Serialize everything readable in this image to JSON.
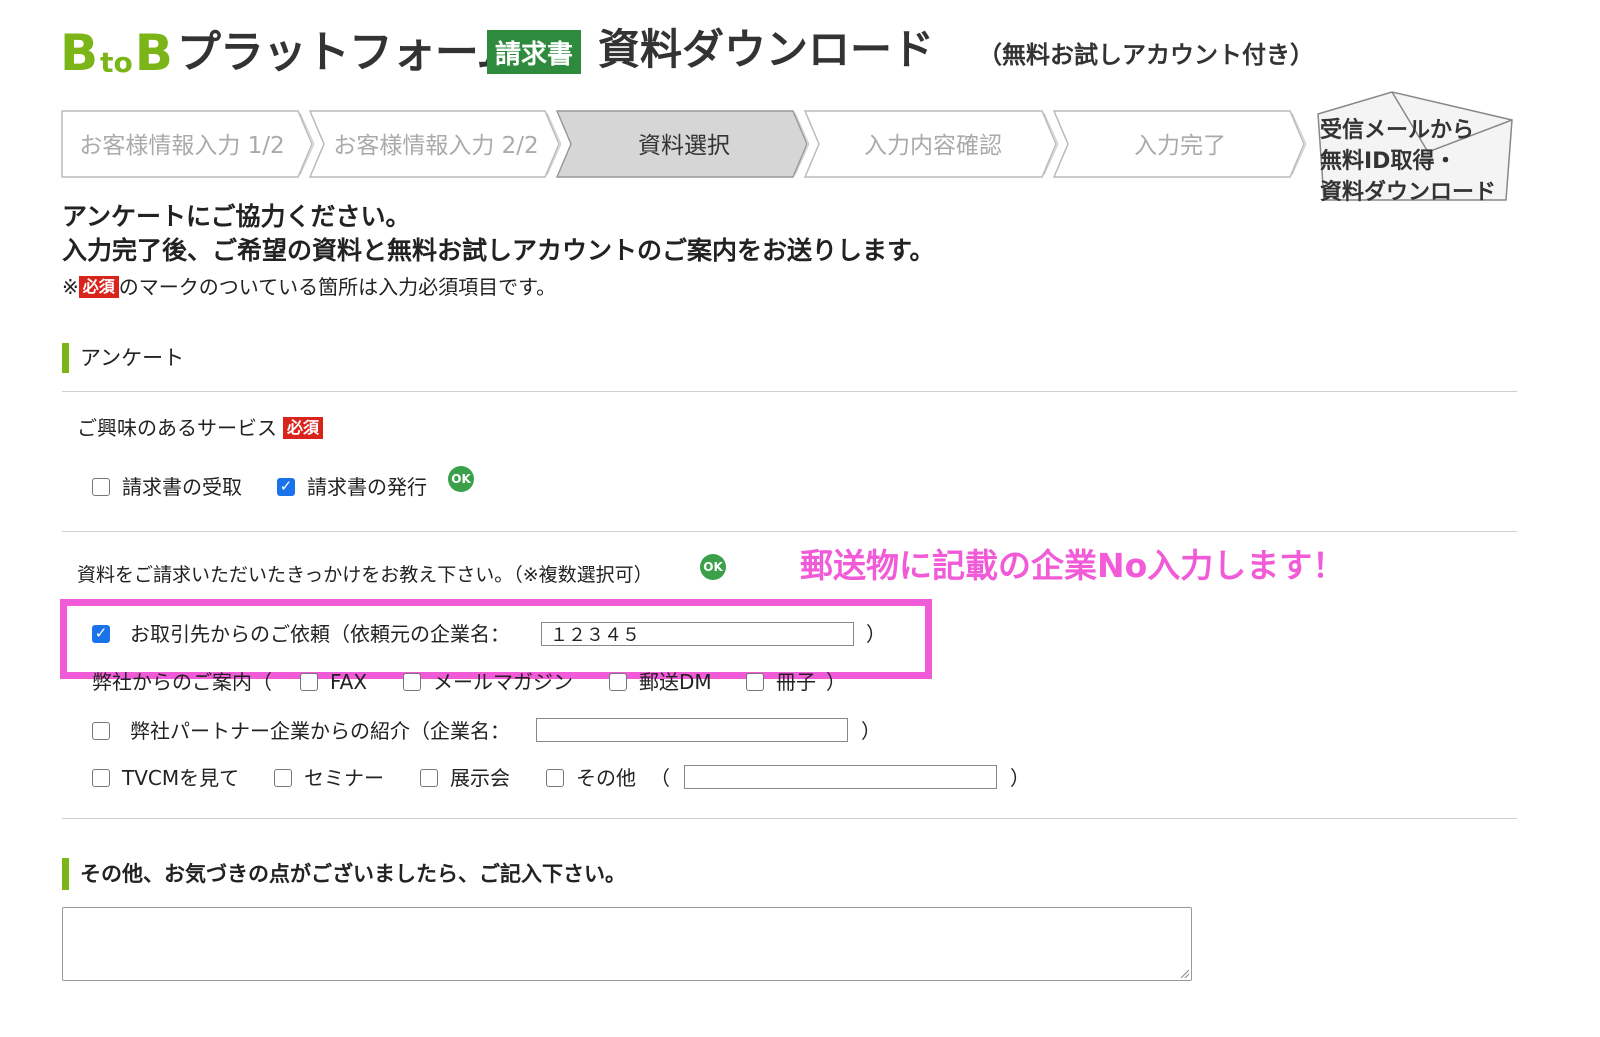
{
  "header": {
    "logo_b1": "B",
    "logo_to": "to",
    "logo_b2": "B",
    "logo_rest": "プラットフォーム",
    "logo_badge": "請求書",
    "title": "資料ダウンロード",
    "subtitle": "（無料お試しアカウント付き）"
  },
  "steps": [
    {
      "label": "お客様情報入力 1/2",
      "state": "done"
    },
    {
      "label": "お客様情報入力 2/2",
      "state": "done"
    },
    {
      "label": "資料選択",
      "state": "current"
    },
    {
      "label": "入力内容確認",
      "state": "pending"
    },
    {
      "label": "入力完了",
      "state": "pending"
    }
  ],
  "envelope": {
    "line1": "受信メールから",
    "line2": "無料ID取得・",
    "line3": "資料ダウンロード"
  },
  "intro": {
    "line1": "アンケートにご協力ください。",
    "line2": "入力完了後、ご希望の資料と無料お試しアカウントのご案内をお送りします。",
    "note_prefix": "※",
    "required_badge": "必須",
    "note_suffix": " のマークのついている箇所は入力必須項目です。"
  },
  "survey": {
    "section_title": "アンケート",
    "q1": {
      "label": "ご興味のあるサービス",
      "required_badge": "必須",
      "options": [
        {
          "label": "請求書の受取",
          "checked": false
        },
        {
          "label": "請求書の発行",
          "checked": true
        }
      ],
      "ok_badge": "OK"
    },
    "q2": {
      "label": "資料をご請求いただいたきっかけをお教え下さい。（※複数選択可）",
      "ok_badge": "OK",
      "callout": "郵送物に記載の企業No入力します！",
      "row1": {
        "label": "お取引先からのご依頼（依頼元の企業名：",
        "checked": true,
        "value": "１２３４５",
        "close": "）"
      },
      "row2": {
        "label": "弊社からのご案内（",
        "options": [
          {
            "label": "FAX",
            "checked": false
          },
          {
            "label": "メールマガジン",
            "checked": false
          },
          {
            "label": "郵送DM",
            "checked": false
          },
          {
            "label": "冊子",
            "checked": false
          }
        ],
        "close": "）"
      },
      "row3": {
        "label": "弊社パートナー企業からの紹介（企業名：",
        "checked": false,
        "value": "",
        "close": "）"
      },
      "row4": {
        "options": [
          {
            "label": "TVCMを見て",
            "checked": false
          },
          {
            "label": "セミナー",
            "checked": false
          },
          {
            "label": "展示会",
            "checked": false
          },
          {
            "label": "その他",
            "checked": false
          }
        ],
        "open": "（",
        "value": "",
        "close": "）"
      }
    }
  },
  "comments": {
    "section_title": "その他、お気づきの点がございましたら、ご記入下さい。",
    "value": ""
  },
  "colors": {
    "brand_green": "#7cb518",
    "badge_green": "#2e8b3d",
    "required_red": "#d9241c",
    "highlight_pink": "#f25bd8",
    "checkbox_blue": "#1a73e8"
  }
}
